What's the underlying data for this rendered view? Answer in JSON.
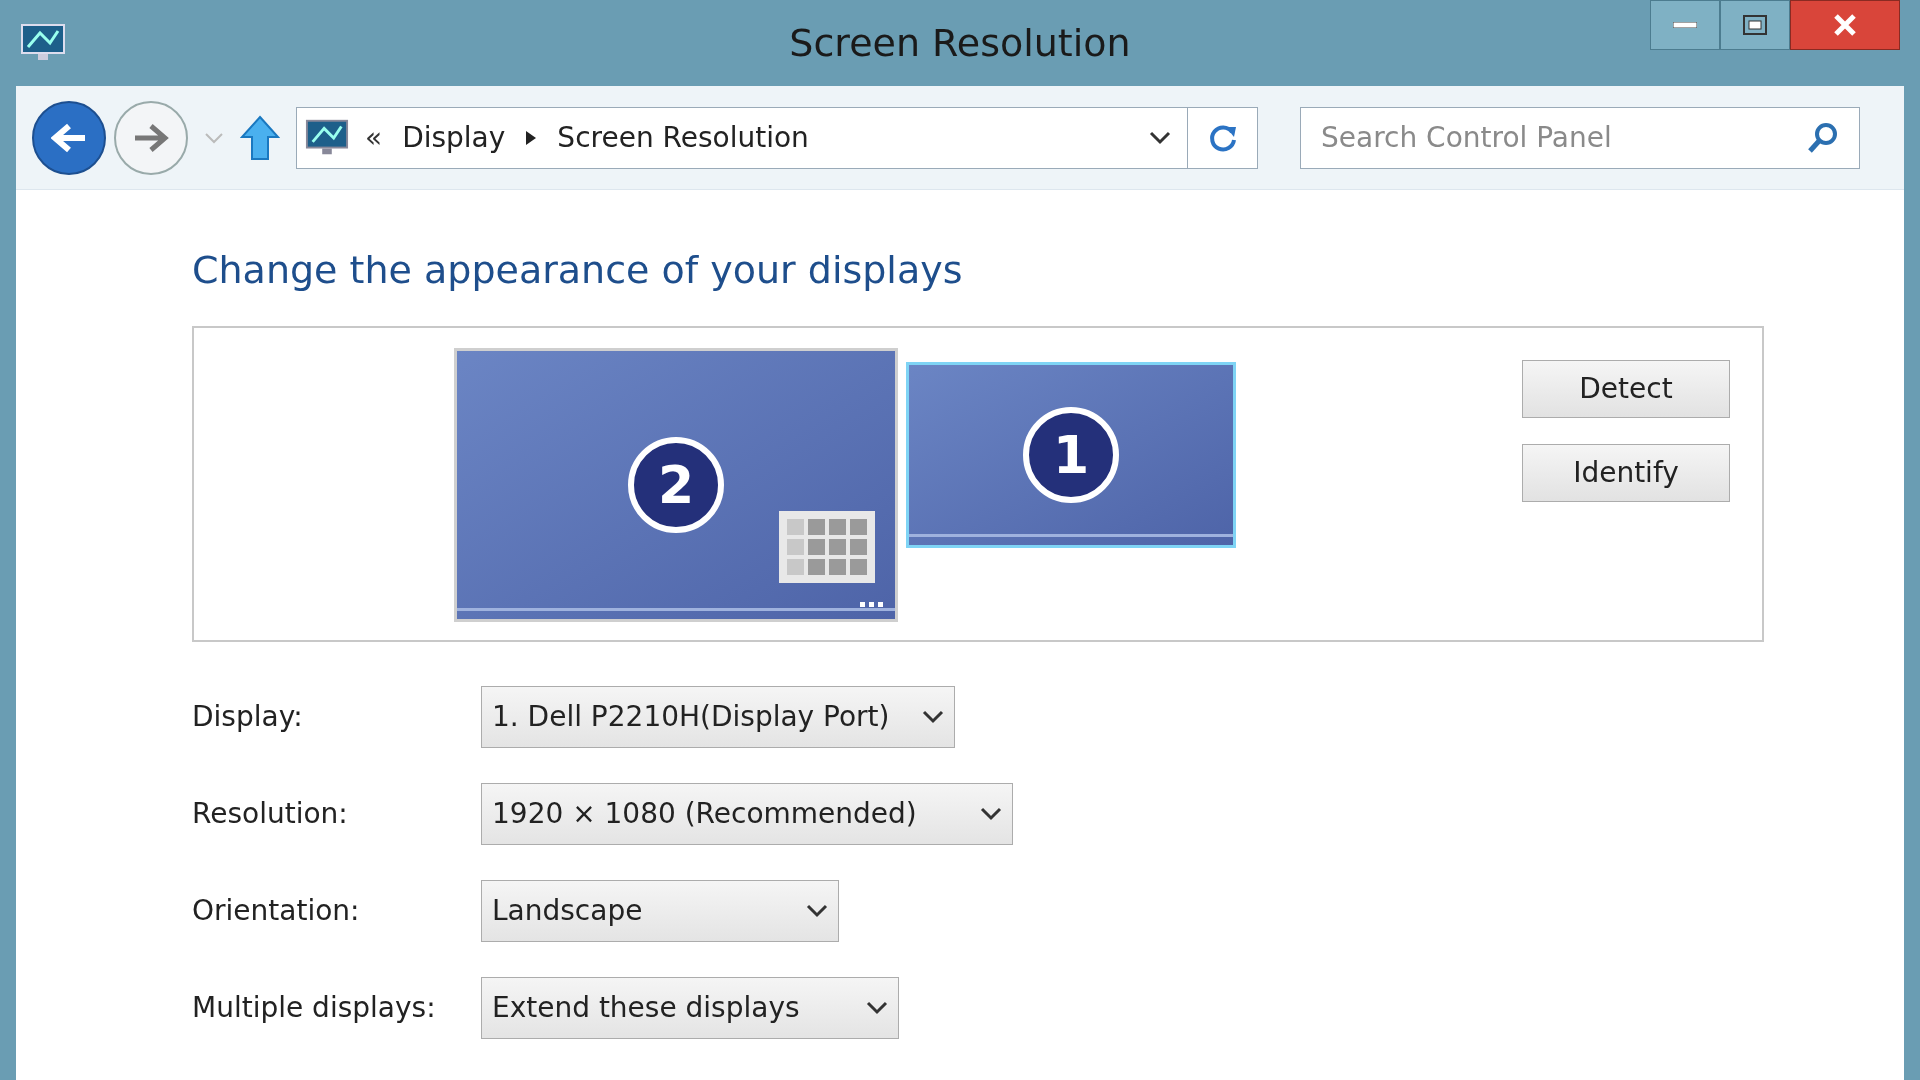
{
  "window": {
    "title": "Screen Resolution"
  },
  "address_bar": {
    "overflow": "«",
    "breadcrumbs": [
      "Display",
      "Screen Resolution"
    ]
  },
  "search": {
    "placeholder": "Search Control Panel"
  },
  "heading": "Change the appearance of your displays",
  "monitors": [
    {
      "number": "2",
      "selected": false
    },
    {
      "number": "1",
      "selected": true
    }
  ],
  "buttons": [
    "Detect",
    "Identify"
  ],
  "settings": [
    {
      "label": "Display:",
      "value": "1. Dell P2210H(Display Port)"
    },
    {
      "label": "Resolution:",
      "value": "1920 × 1080 (Recommended)"
    },
    {
      "label": "Orientation:",
      "value": "Landscape"
    },
    {
      "label": "Multiple displays:",
      "value": "Extend these displays"
    }
  ]
}
